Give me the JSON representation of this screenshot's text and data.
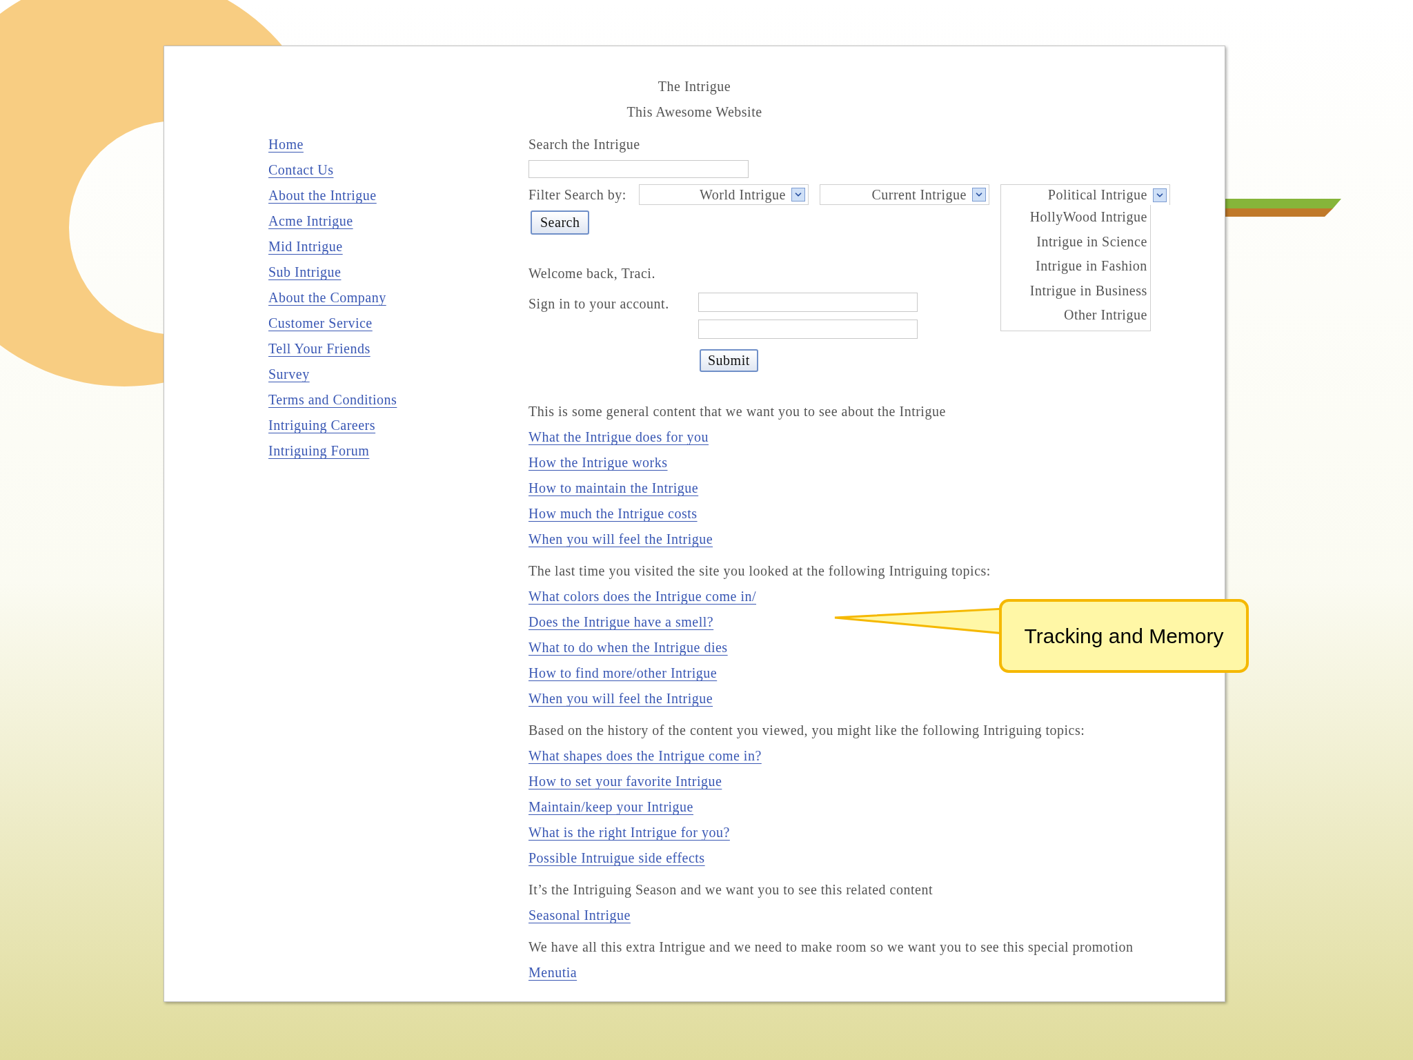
{
  "header": {
    "title": "The Intrigue",
    "subtitle": "This Awesome Website"
  },
  "nav": [
    "Home",
    "Contact Us",
    "About the Intrigue",
    "Acme Intrigue",
    "Mid Intrigue",
    "Sub Intrigue",
    "About the Company",
    "Customer Service",
    "Tell Your Friends",
    "Survey",
    "Terms and Conditions",
    "Intriguing Careers",
    "Intriguing Forum"
  ],
  "search": {
    "label": "Search the Intrigue",
    "button": "Search"
  },
  "filter": {
    "label": "Filter Search by:",
    "dropdowns": [
      {
        "value": "World Intrigue",
        "expanded": false
      },
      {
        "value": "Current Intrigue",
        "expanded": false
      },
      {
        "value": "Political Intrigue",
        "expanded": true,
        "options": [
          "HollyWood Intrigue",
          "Intrigue in Science",
          "Intrigue in Fashion",
          "Intrigue in Business",
          "Other Intrigue"
        ]
      }
    ]
  },
  "welcome": "Welcome back, Traci.",
  "sign_in": {
    "label": "Sign in to your account.",
    "button": "Submit"
  },
  "sections": [
    {
      "intro": "This is some general content that we want you to see about the Intrigue",
      "links": [
        "What the Intrigue does for you",
        "How the Intrigue works",
        "How to maintain the Intrigue",
        "How much the Intrigue costs",
        "When you will feel the Intrigue"
      ]
    },
    {
      "intro": "The last time you visited the site you looked at the following Intriguing topics:",
      "links": [
        "What colors does the Intrigue come in/",
        "Does the Intrigue have a smell?",
        "What to do when the Intrigue dies",
        "How to find more/other Intrigue",
        "When you will feel the Intrigue"
      ]
    },
    {
      "intro": "Based on the history of the content you viewed, you might like the following Intriguing topics:",
      "links": [
        "What shapes does the Intrigue come in?",
        "How to set your favorite Intrigue",
        "Maintain/keep your Intrigue",
        "What is the right Intrigue for you?",
        "Possible Intruigue side effects"
      ]
    },
    {
      "intro": "It’s the Intriguing Season and we want you to see this related content",
      "links": [
        "Seasonal Intrigue"
      ]
    },
    {
      "intro": "We have all this extra Intrigue and we need to make room so we want you to see this special promotion",
      "links": [
        "Menutia"
      ]
    }
  ],
  "callout": {
    "text": "Tracking and Memory"
  }
}
